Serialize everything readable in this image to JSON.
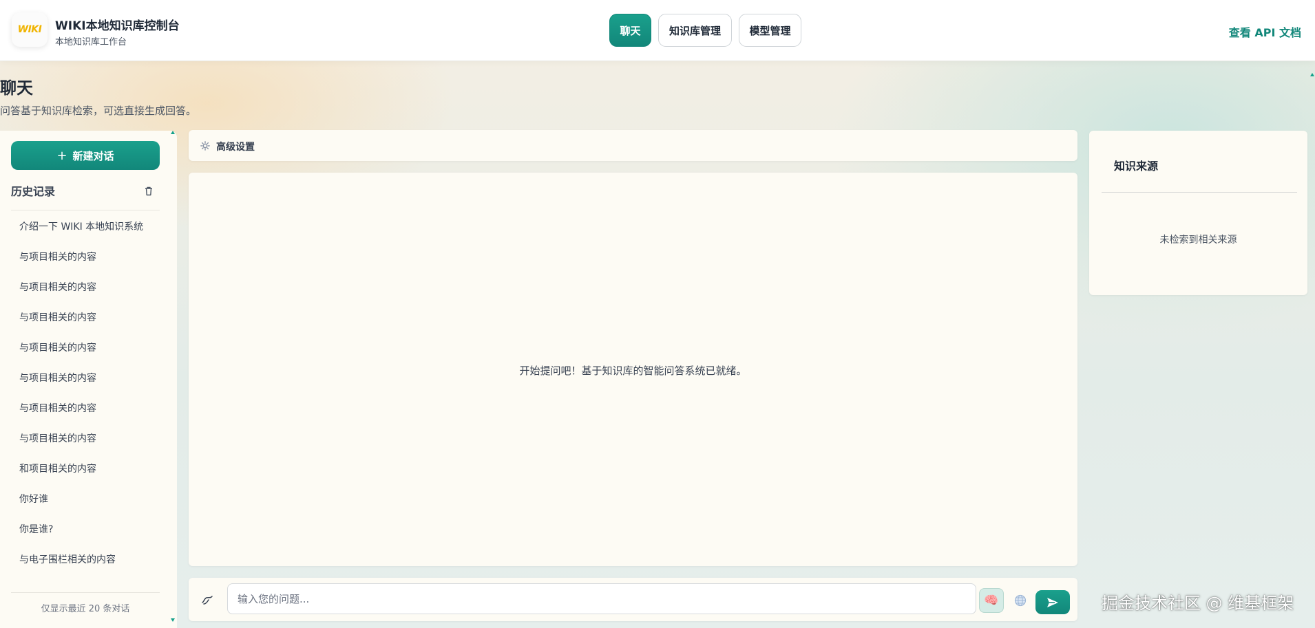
{
  "header": {
    "logo_text": "WIKI",
    "title": "WIKI本地知识库控制台",
    "subtitle": "本地知识库工作台",
    "nav": [
      {
        "label": "聊天",
        "active": true
      },
      {
        "label": "知识库管理",
        "active": false
      },
      {
        "label": "模型管理",
        "active": false
      }
    ],
    "api_link": "查看 API 文档"
  },
  "page": {
    "title": "聊天",
    "description": "问答基于知识库检索，可选直接生成回答。"
  },
  "sidebar": {
    "new_chat_label": "新建对话",
    "history_title": "历史记录",
    "history": [
      "介绍一下 WIKI 本地知识系统",
      "与项目相关的内容",
      "与项目相关的内容",
      "与项目相关的内容",
      "与项目相关的内容",
      "与项目相关的内容",
      "与项目相关的内容",
      "与项目相关的内容",
      "和项目相关的内容",
      "你好谁",
      "你是谁?",
      "与电子围栏相关的内容"
    ],
    "history_note": "仅显示最近 20 条对话"
  },
  "advanced": {
    "label": "高级设置"
  },
  "chat": {
    "empty_message": "开始提问吧！基于知识库的智能问答系统已就绪。",
    "input_placeholder": "输入您的问题..."
  },
  "sources": {
    "title": "知识来源",
    "empty": "未检索到相关来源"
  },
  "watermark": "掘金技术社区 @ 维基框架",
  "colors": {
    "accent": "#12877a",
    "logo": "#f0b400"
  }
}
